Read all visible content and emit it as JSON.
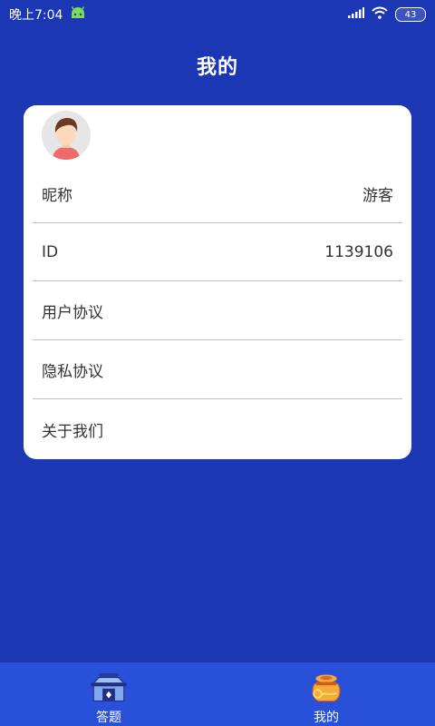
{
  "status_bar": {
    "time": "晚上7:04",
    "battery": "43"
  },
  "page": {
    "title": "我的"
  },
  "profile": {
    "rows": [
      {
        "label": "昵称",
        "value": "游客"
      },
      {
        "label": "ID",
        "value": "1139106"
      },
      {
        "label": "用户协议",
        "value": ""
      },
      {
        "label": "隐私协议",
        "value": ""
      },
      {
        "label": "关于我们",
        "value": ""
      }
    ]
  },
  "tabbar": {
    "tabs": [
      {
        "label": "答题",
        "icon": "temple-icon"
      },
      {
        "label": "我的",
        "icon": "money-bag-icon"
      }
    ]
  },
  "colors": {
    "background": "#1b37b3",
    "tabbar": "#2850d8",
    "card": "#ffffff"
  }
}
